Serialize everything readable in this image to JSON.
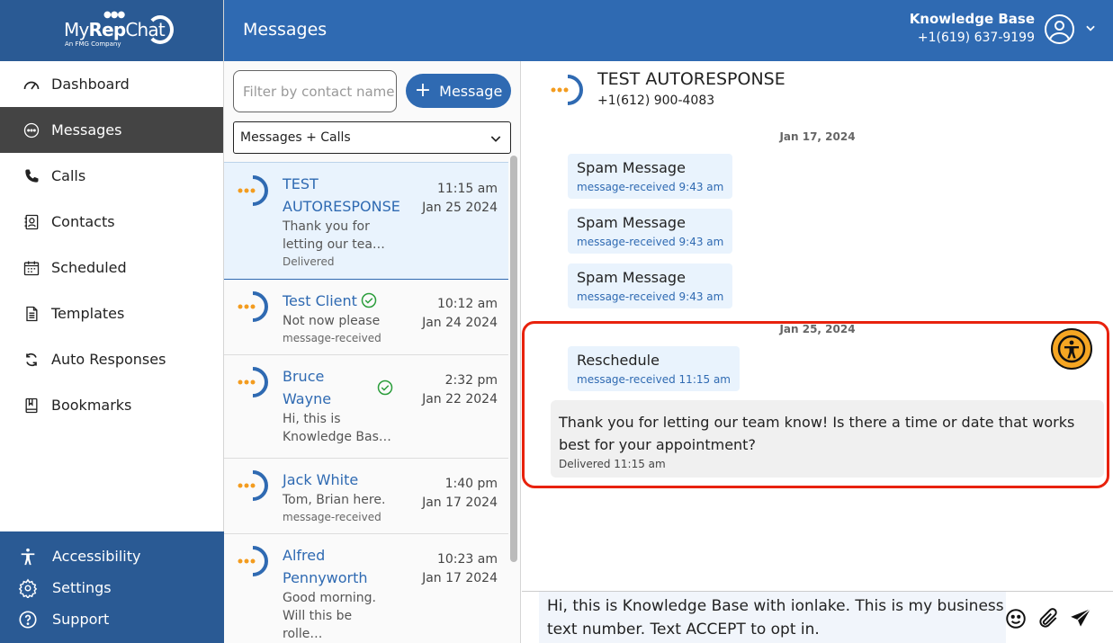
{
  "brand": {
    "name_prefix": "My",
    "name_bold": "Rep",
    "name_suffix": "Chat",
    "tagline": "An FMG Company"
  },
  "sidebar": {
    "items": [
      {
        "label": "Dashboard",
        "icon": "gauge-icon"
      },
      {
        "label": "Messages",
        "icon": "chat-bubble-icon",
        "active": true
      },
      {
        "label": "Calls",
        "icon": "phone-icon"
      },
      {
        "label": "Contacts",
        "icon": "contact-book-icon"
      },
      {
        "label": "Scheduled",
        "icon": "calendar-icon"
      },
      {
        "label": "Templates",
        "icon": "document-icon"
      },
      {
        "label": "Auto Responses",
        "icon": "refresh-icon"
      },
      {
        "label": "Bookmarks",
        "icon": "bookmark-icon"
      }
    ],
    "bottom": [
      {
        "label": "Accessibility",
        "icon": "accessibility-icon"
      },
      {
        "label": "Settings",
        "icon": "gear-icon"
      },
      {
        "label": "Support",
        "icon": "help-icon"
      }
    ]
  },
  "header": {
    "title": "Messages",
    "account_name": "Knowledge Base",
    "account_phone": "+1(619) 637-9199"
  },
  "list": {
    "filter_placeholder": "Filter by contact name",
    "new_message_label": "Message",
    "type_filter": "Messages + Calls",
    "conversations": [
      {
        "name": "TEST AUTORESPONSE",
        "preview": "Thank you for letting our tea…",
        "status": "Delivered",
        "time": "11:15 am",
        "date": "Jan 25 2024",
        "active": true,
        "verified": false
      },
      {
        "name": "Test Client",
        "preview": "Not now please",
        "status": "message-received",
        "time": "10:12 am",
        "date": "Jan 24 2024",
        "verified": true
      },
      {
        "name": "Bruce Wayne",
        "preview": "Hi, this is Knowledge Bas…",
        "status": "",
        "time": "2:32 pm",
        "date": "Jan 22 2024",
        "verified": true
      },
      {
        "name": "Jack White",
        "preview": "Tom, Brian here.",
        "status": "message-received",
        "time": "1:40 pm",
        "date": "Jan 17 2024",
        "verified": false
      },
      {
        "name": "Alfred Pennyworth",
        "preview": "Good morning. Will this be rolle…",
        "status": "message-received",
        "time": "10:23 am",
        "date": "Jan 17 2024",
        "verified": false
      }
    ]
  },
  "thread": {
    "contact_name": "TEST AUTORESPONSE",
    "contact_phone": "+1(612) 900-4083",
    "date1": "Jan 17, 2024",
    "date2": "Jan 25, 2024",
    "incoming": [
      {
        "text": "Spam Message",
        "meta": "message-received 9:43 am"
      },
      {
        "text": "Spam Message",
        "meta": "message-received 9:43 am"
      },
      {
        "text": "Spam Message",
        "meta": "message-received 9:43 am"
      },
      {
        "text": "Reschedule",
        "meta": "message-received 11:15 am"
      }
    ],
    "outgoing": {
      "text": "Thank you for letting our team know! Is there a time or date that works best for your appointment?",
      "meta": "Delivered 11:15 am"
    },
    "composer_text": "Hi, this is Knowledge Base with ionlake. This is my business text number. Text ACCEPT to opt in."
  },
  "colors": {
    "brand_dark": "#2a5a94",
    "brand": "#2f6ab2",
    "highlight": "#e8220d",
    "a11y_fab": "#f5a623",
    "dots": "#f39c1f"
  }
}
